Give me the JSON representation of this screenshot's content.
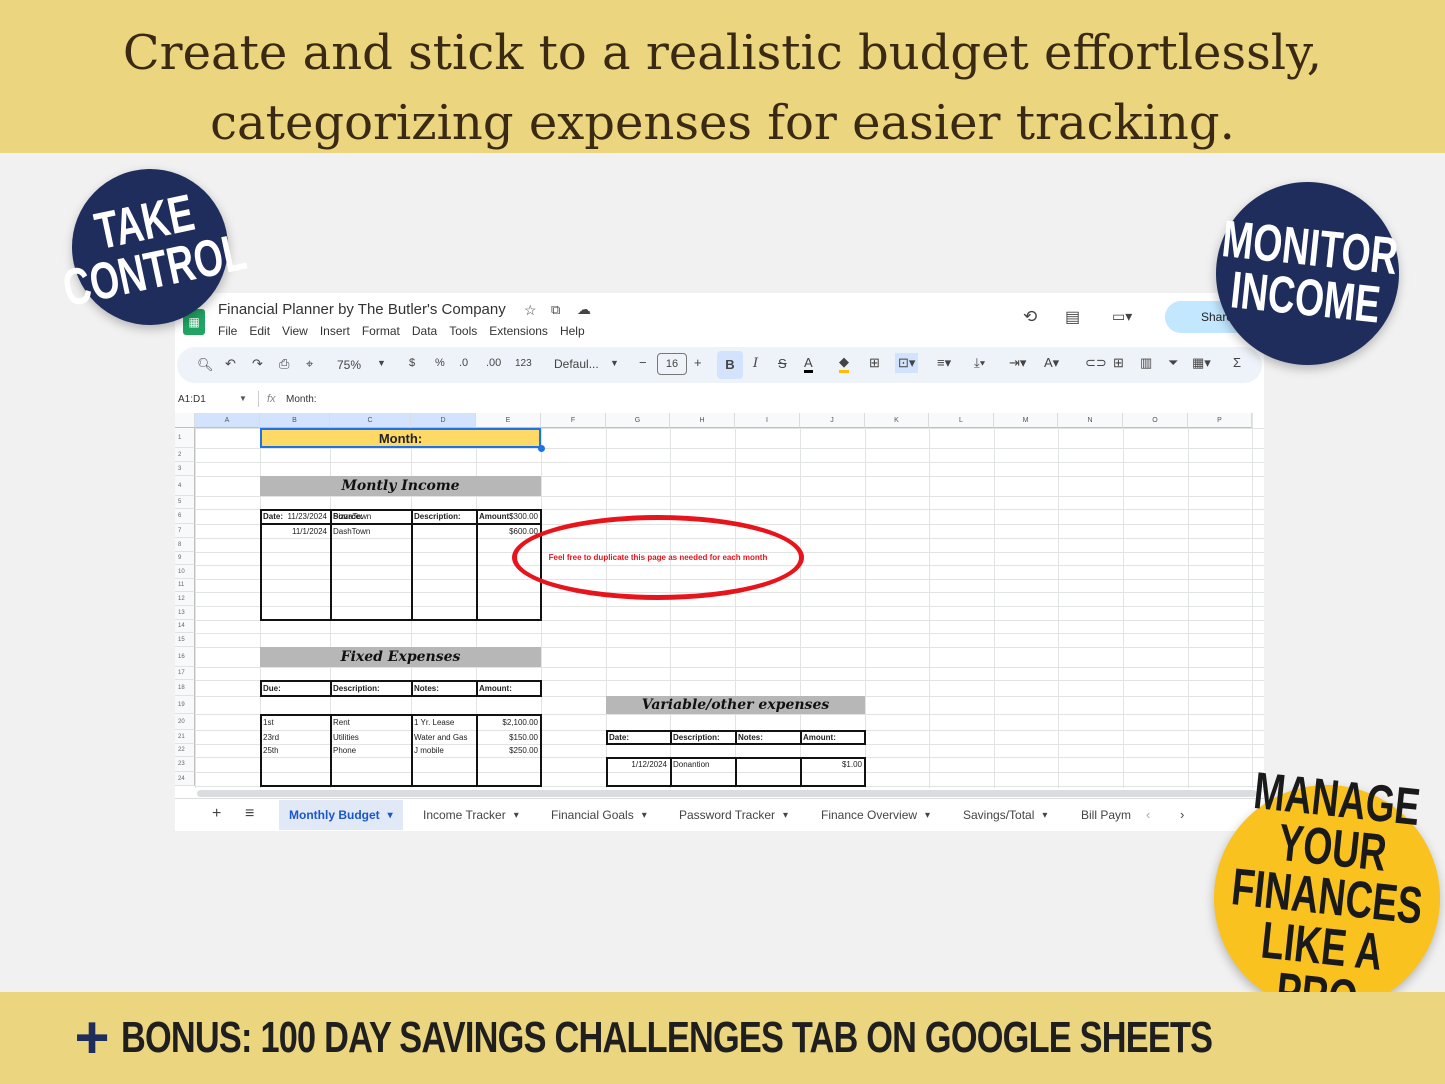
{
  "banner_top": {
    "line1": "Create and stick to a realistic budget effortlessly,",
    "line2": "categorizing expenses for easier tracking."
  },
  "badges": {
    "take_control": [
      "TAKE",
      "CONTROL"
    ],
    "monitor_income": [
      "MONITOR",
      "INCOME"
    ],
    "manage": [
      "MANAGE",
      "YOUR",
      "FINANCES",
      "LIKE A PRO"
    ]
  },
  "banner_bottom": {
    "icon": "plus-icon",
    "text": "BONUS: 100 DAY SAVINGS CHALLENGES TAB ON GOOGLE SHEETS"
  },
  "sheet": {
    "title": "Financial Planner by The Butler's Company",
    "menu": [
      "File",
      "Edit",
      "View",
      "Insert",
      "Format",
      "Data",
      "Tools",
      "Extensions",
      "Help"
    ],
    "share_label": "Share",
    "toolbar": {
      "zoom": "75%",
      "currency": "$",
      "percent": "%",
      "dec_less": ".0",
      "dec_more": ".00",
      "number_format": "123",
      "font": "Defaul...",
      "font_size": "16"
    },
    "name_box": "A1:D1",
    "formula": "Month:",
    "columns": [
      "A",
      "B",
      "C",
      "D",
      "E",
      "F",
      "G",
      "H",
      "I",
      "J",
      "K",
      "L",
      "M",
      "N",
      "O",
      "P"
    ],
    "rows": [
      "1",
      "2",
      "3",
      "4",
      "5",
      "6",
      "7",
      "8",
      "9",
      "10",
      "11",
      "12",
      "13",
      "14",
      "15",
      "16",
      "17",
      "18",
      "19",
      "20",
      "21",
      "22",
      "23",
      "24"
    ],
    "month_label": "Month:",
    "income": {
      "title": "Montly Income",
      "headers": [
        "Date:",
        "Source:",
        "Description:",
        "Amount:"
      ],
      "rows": [
        [
          "11/23/2024",
          "PizzaTown",
          "",
          "$300.00"
        ],
        [
          "11/1/2024",
          "DashTown",
          "",
          "$600.00"
        ]
      ]
    },
    "fixed": {
      "title": "Fixed Expenses",
      "headers": [
        "Due:",
        "Description:",
        "Notes:",
        "Amount:"
      ],
      "rows": [
        [
          "1st",
          "Rent",
          "1 Yr. Lease",
          "$2,100.00"
        ],
        [
          "23rd",
          "Utilities",
          "Water and Gas",
          "$150.00"
        ],
        [
          "25th",
          "Phone",
          "J mobile",
          "$250.00"
        ]
      ]
    },
    "variable": {
      "title": "Variable/other expenses",
      "headers": [
        "Date:",
        "Description:",
        "Notes:",
        "Amount:"
      ],
      "rows": [
        [
          "1/12/2024",
          "Donantion",
          "",
          "$1.00"
        ]
      ]
    },
    "note": "Feel free to duplicate this page as needed for each month",
    "note_color": "#e8141b",
    "tabs": [
      "Monthly Budget",
      "Income Tracker",
      "Financial Goals",
      "Password Tracker",
      "Finance Overview",
      "Savings/Total",
      "Bill Paym"
    ],
    "active_tab": "Monthly Budget"
  }
}
